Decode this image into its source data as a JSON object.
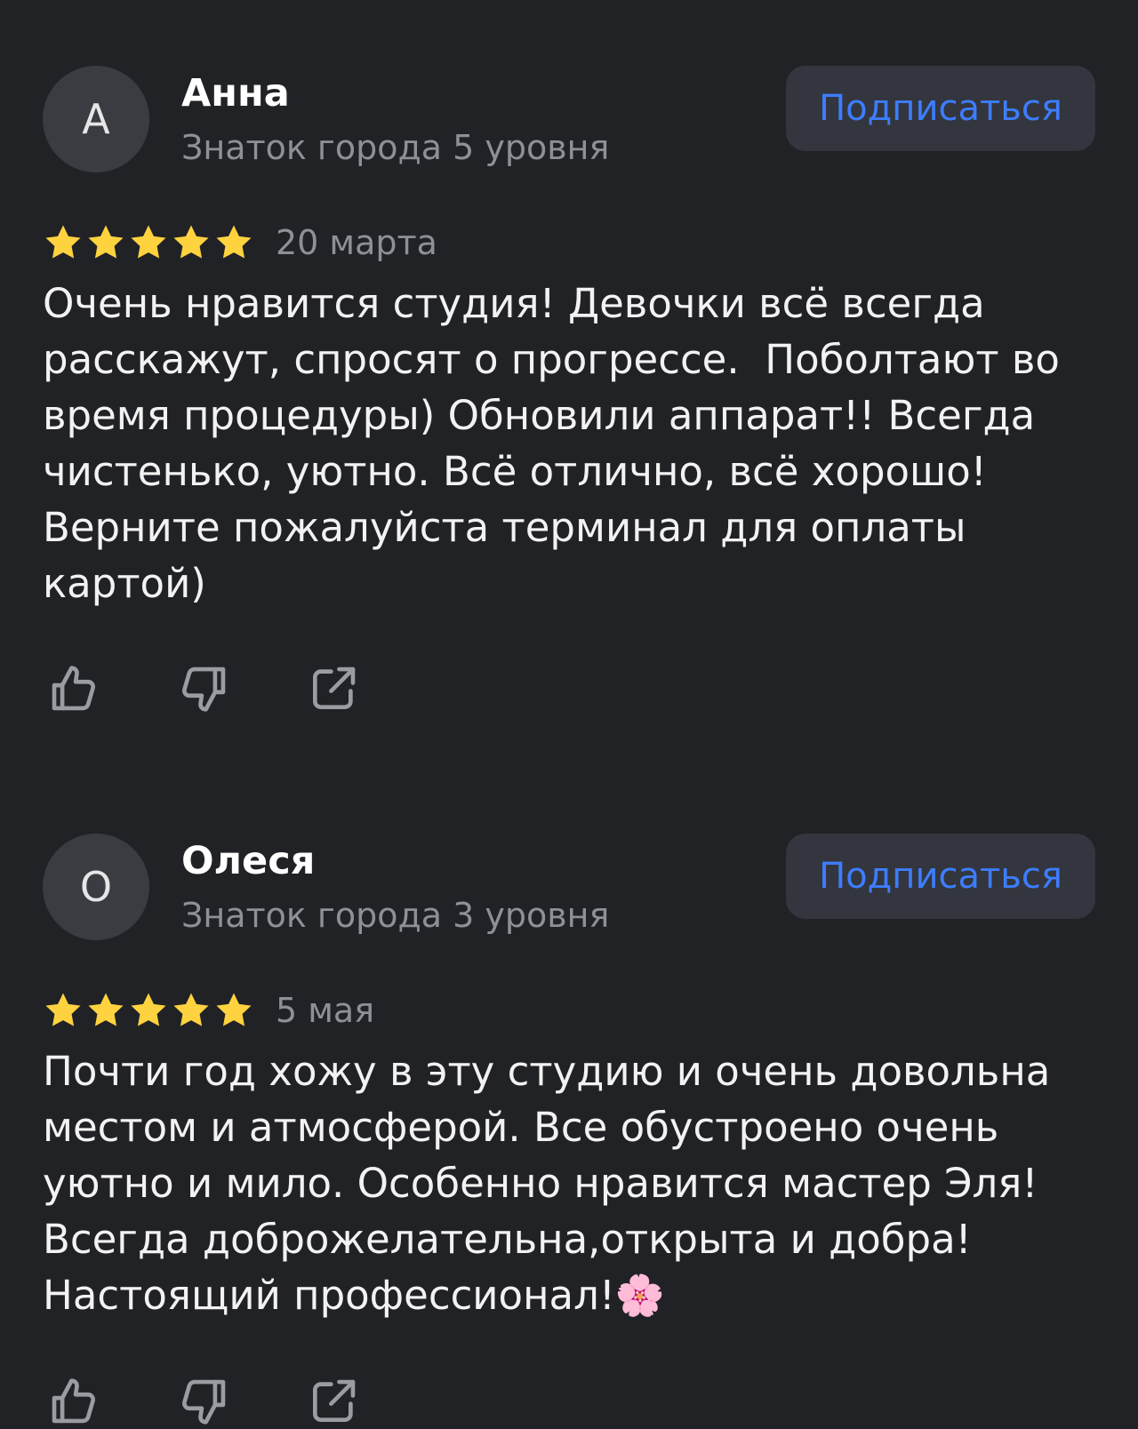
{
  "reviews": [
    {
      "avatar_letter": "А",
      "name": "Анна",
      "level": "Знаток города 5 уровня",
      "subscribe_label": "Подписаться",
      "rating": 5,
      "date": "20 марта",
      "text": "Очень нравится студия! Девочки всё всегда расскажут, спросят о прогрессе.  Поболтают во время процедуры) Обновили аппарат!! Всегда чистенько, уютно. Всё отлично, всё хорошо! Верните пожалуйста терминал для оплаты картой)"
    },
    {
      "avatar_letter": "О",
      "name": "Олеся",
      "level": "Знаток города 3 уровня",
      "subscribe_label": "Подписаться",
      "rating": 5,
      "date": "5 мая",
      "text": "Почти год хожу в эту студию и очень довольна местом и атмосферой. Все обустроено очень уютно и мило. Особенно нравится мастер Эля! Всегда доброжелательна,открыта и добра! Настоящий профессионал!🌸"
    }
  ],
  "icons": {
    "like": "thumbs-up-icon",
    "dislike": "thumbs-down-icon",
    "share": "share-icon",
    "star": "star-icon"
  },
  "colors": {
    "background": "#212226",
    "accent": "#3d7dff",
    "star": "#ffd23f",
    "muted": "#8e9096"
  }
}
